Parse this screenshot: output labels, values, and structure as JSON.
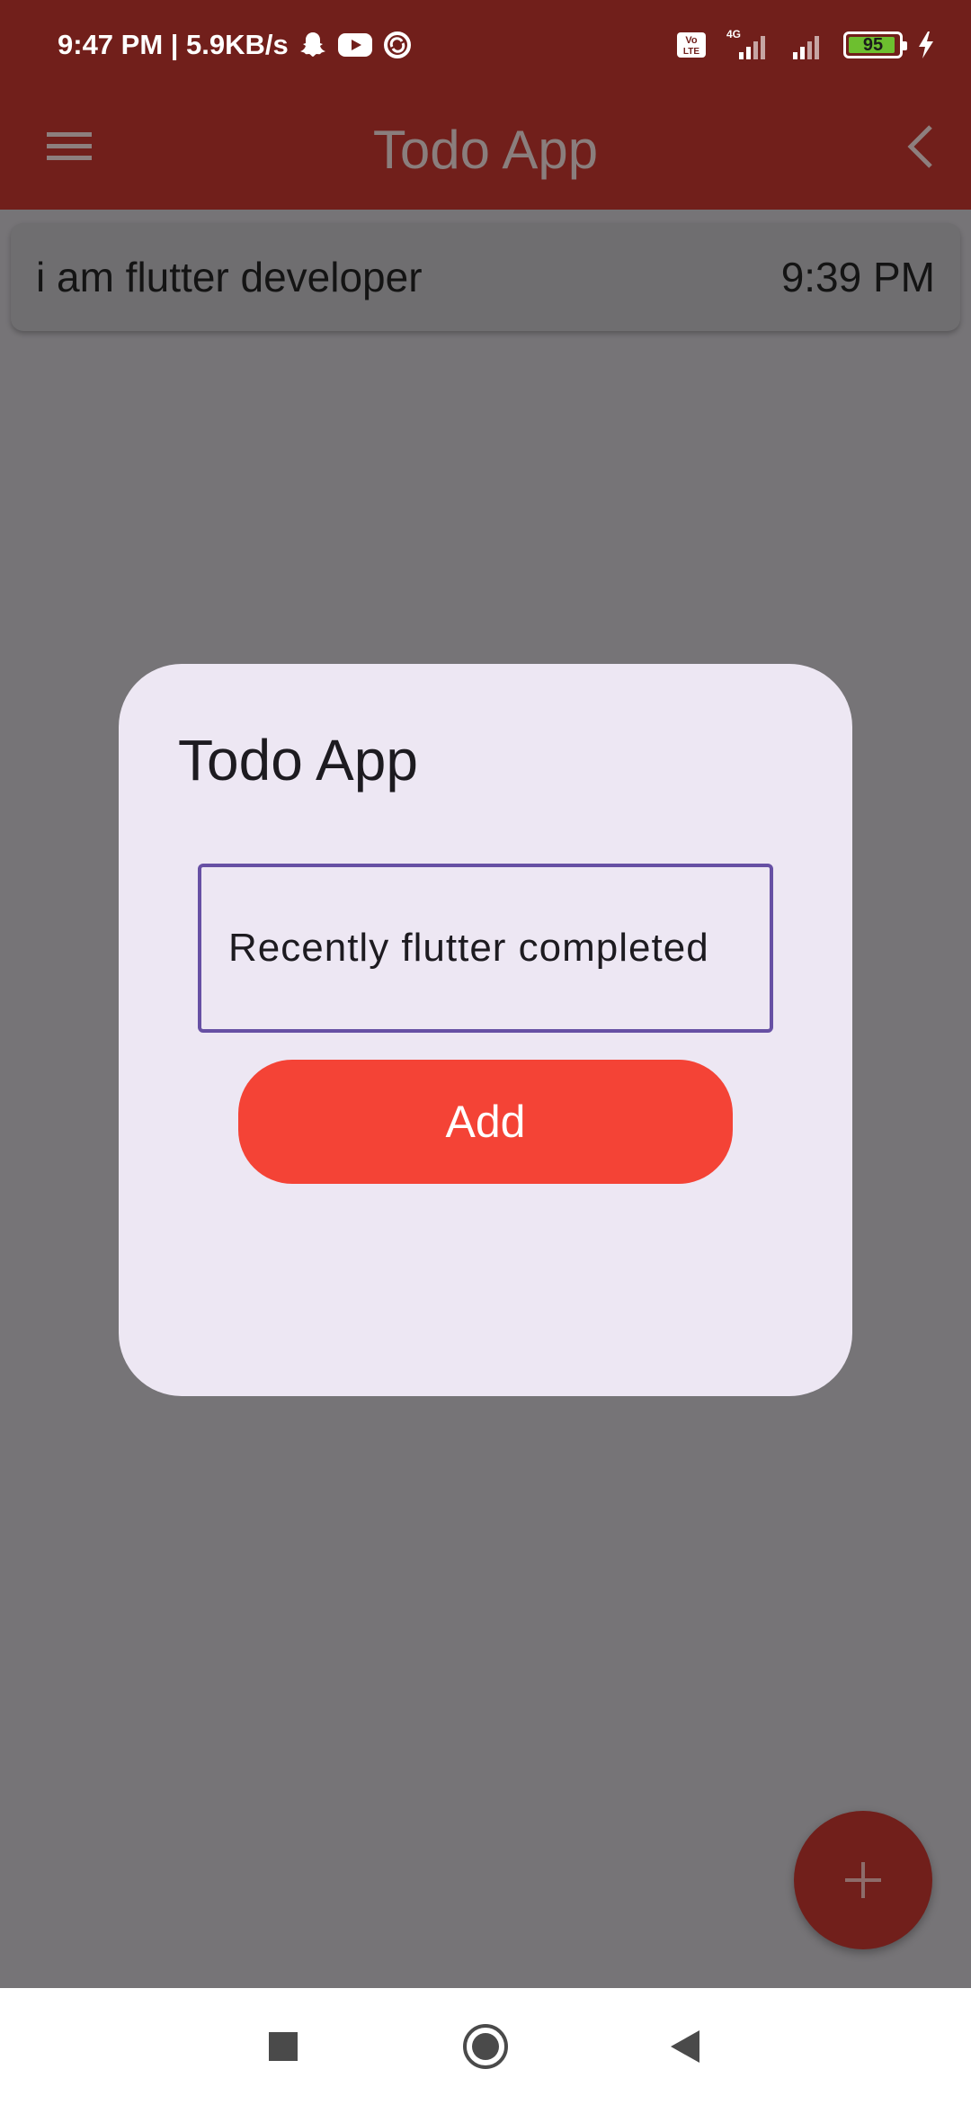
{
  "status_bar": {
    "time_speed": "9:47 PM | 5.9KB/s",
    "network_type": "4G",
    "volte_label": "Vo LTE",
    "battery_level": "95",
    "icons": [
      "snapchat-icon",
      "youtube-icon",
      "sync-icon",
      "volte-icon",
      "signal-icon",
      "signal-icon",
      "battery-icon",
      "charging-icon"
    ]
  },
  "app_bar": {
    "title": "Todo App",
    "menu_icon": "hamburger-menu-icon",
    "back_icon": "chevron-left-icon"
  },
  "todo_list": {
    "items": [
      {
        "text": "i am flutter developer",
        "time": "9:39 PM"
      }
    ]
  },
  "dialog": {
    "title": "Todo App",
    "input_value": "Recently flutter completed",
    "add_label": "Add"
  },
  "fab": {
    "icon": "plus-icon"
  },
  "nav_bar": {
    "icons": [
      "recents-square-icon",
      "home-circle-icon",
      "back-triangle-icon"
    ]
  },
  "colors": {
    "app_bar": "#711f1b",
    "scrim_background": "#767477",
    "dialog_background": "#ede7f3",
    "input_border": "#6750a4",
    "add_button": "#f44336"
  }
}
